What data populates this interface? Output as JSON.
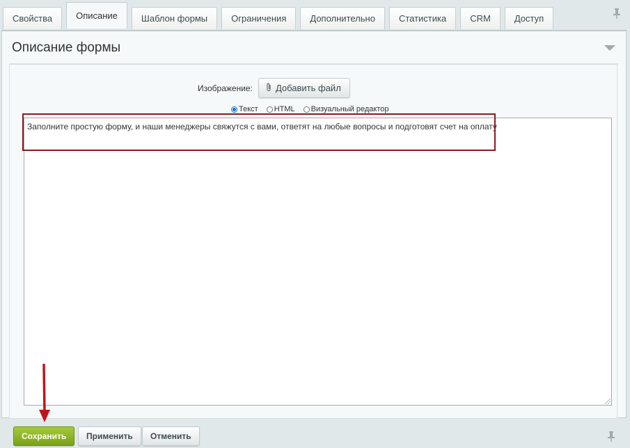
{
  "tabs": [
    {
      "label": "Свойства",
      "active": false
    },
    {
      "label": "Описание",
      "active": true
    },
    {
      "label": "Шаблон формы",
      "active": false
    },
    {
      "label": "Ограничения",
      "active": false
    },
    {
      "label": "Дополнительно",
      "active": false
    },
    {
      "label": "Статистика",
      "active": false
    },
    {
      "label": "CRM",
      "active": false
    },
    {
      "label": "Доступ",
      "active": false
    }
  ],
  "panel": {
    "title": "Описание формы",
    "image_label": "Изображение:",
    "add_file_label": "Добавить файл",
    "radio_options": [
      {
        "label": "Текст",
        "checked": true
      },
      {
        "label": "HTML",
        "checked": false
      },
      {
        "label": "Визуальный редактор",
        "checked": false
      }
    ],
    "description_text": "Заполните простую форму, и наши менеджеры свяжутся с вами, ответят на любые вопросы и подготовят счет на оплату"
  },
  "buttons": {
    "save": "Сохранить",
    "apply": "Применить",
    "cancel": "Отменить"
  },
  "colors": {
    "accent_green": "#8bb72a",
    "highlight_red": "#8b1a1f",
    "arrow_red": "#c0141c"
  }
}
